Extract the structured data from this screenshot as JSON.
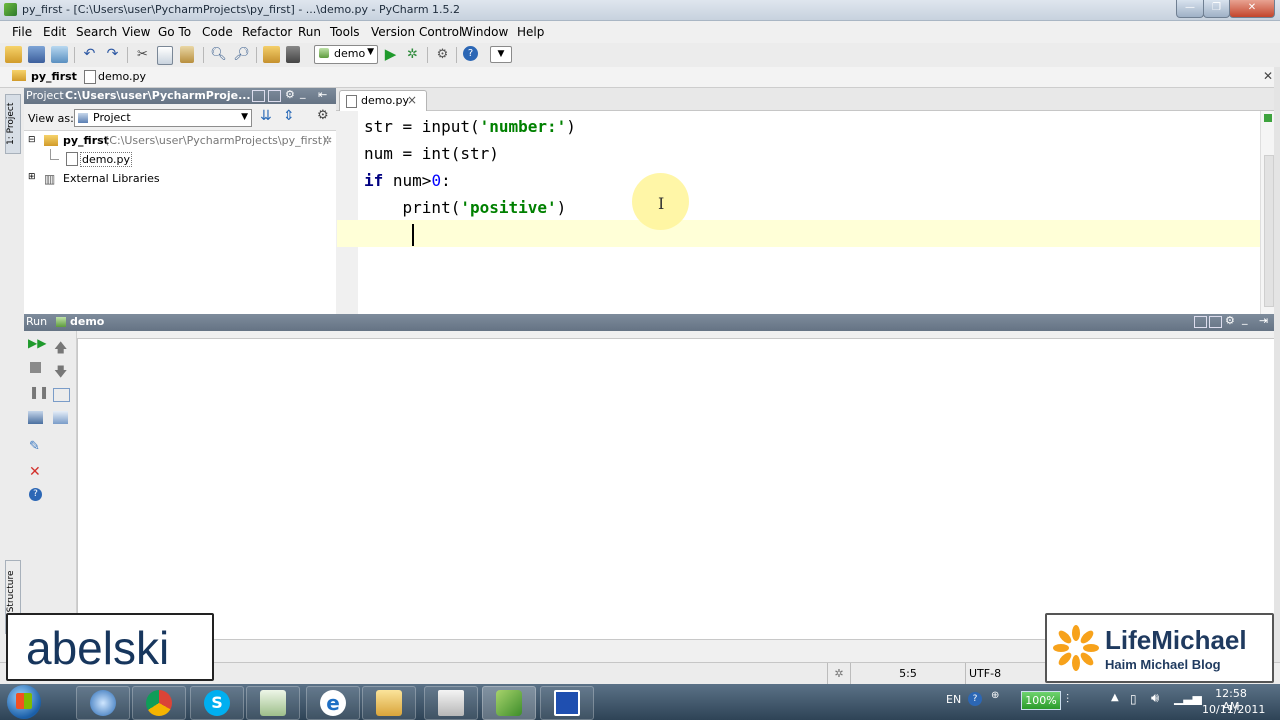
{
  "window": {
    "title": "py_first - [C:\\Users\\user\\PycharmProjects\\py_first] - ...\\demo.py - PyCharm 1.5.2",
    "min_label": "—",
    "max_label": "❐",
    "close_label": "✕"
  },
  "menu": [
    "File",
    "Edit",
    "Search",
    "View",
    "Go To",
    "Code",
    "Refactor",
    "Run",
    "Tools",
    "Version Control",
    "Window",
    "Help"
  ],
  "toolbar": {
    "run_config": "demo"
  },
  "navbar": {
    "crumb1": "py_first",
    "crumb2": "demo.py"
  },
  "sidebar": {
    "project_tab": "1: Project",
    "structure_tab": "2: Structure"
  },
  "project": {
    "header": "Project",
    "header_path": "C:\\Users\\user\\PycharmProje...",
    "view_as_label": "View as:",
    "view_as_value": "Project",
    "tree": {
      "root_name": "py_first",
      "root_path": "(C:\\Users\\user\\PycharmProjects\\py_first)",
      "file": "demo.py",
      "libs": "External Libraries"
    }
  },
  "editor": {
    "tab": "demo.py",
    "tab_close": "×",
    "lines": [
      {
        "a": "str = input(",
        "s": "'number:'",
        "b": ")"
      },
      {
        "a": "num = int(str)"
      },
      {
        "k": "if",
        "a": " num>",
        "n": "0",
        "b": ":"
      },
      {
        "a": "    print(",
        "s": "'positive'",
        "b": ")"
      }
    ]
  },
  "run": {
    "label": "Run",
    "config": "demo"
  },
  "status": {
    "position": "5:5",
    "encoding": "UTF-8"
  },
  "taskbar": {
    "lang": "EN",
    "zoom": "100%",
    "time": "12:58 AM",
    "date": "10/11/2011"
  },
  "watermarks": {
    "left": "abelski",
    "right_title": "LifeMichael",
    "right_sub": "Haim Michael Blog"
  },
  "colors": {
    "keyword": "#000080",
    "string": "#008000",
    "number": "#0000ff",
    "current_line": "#ffffd7",
    "cursor_highlight": "#fff59d"
  }
}
